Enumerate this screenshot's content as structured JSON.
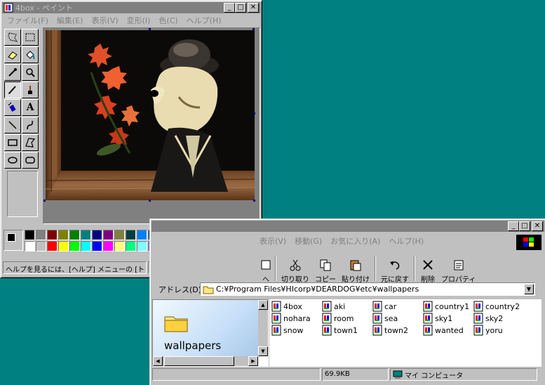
{
  "paint": {
    "title": "4box - ペイント",
    "menu": [
      "ファイル(F)",
      "編集(E)",
      "表示(V)",
      "変形(I)",
      "色(C)",
      "ヘルプ(H)"
    ],
    "status": "ヘルプを見るには、[ヘルプ] メニューの [トピッ"
  },
  "explorer": {
    "menu": [
      "表示(V)",
      "移動(G)",
      "お気に入り(A)",
      "ヘルプ(H)"
    ],
    "toolbar": {
      "back_partial": "へ",
      "cut": "切り取り",
      "copy": "コピー",
      "paste": "貼り付け",
      "undo": "元に戻す",
      "delete": "削除",
      "properties": "プロパティ"
    },
    "address_label": "アドレス(D)",
    "address_value": "C:¥Program Files¥HIcorp¥DEARDOG¥etc¥wallpapers",
    "folder_name": "wallpapers",
    "files": [
      "4box",
      "aki",
      "car",
      "country1",
      "country2",
      "nohara",
      "room",
      "sea",
      "sky1",
      "sky2",
      "snow",
      "town1",
      "town2",
      "wanted",
      "yoru"
    ],
    "status_size": "69.9KB",
    "status_location": "マイ コンピュータ"
  },
  "colors": {
    "palette_top": [
      "#000000",
      "#808080",
      "#800000",
      "#808000",
      "#008000",
      "#008080",
      "#000080",
      "#800080",
      "#808040",
      "#004040",
      "#0080ff",
      "#004080",
      "#4000ff",
      "#804000"
    ],
    "palette_bottom": [
      "#ffffff",
      "#c0c0c0",
      "#ff0000",
      "#ffff00",
      "#00ff00",
      "#00ffff",
      "#0000ff",
      "#ff00ff",
      "#ffff80",
      "#00ff80",
      "#80ffff",
      "#8080ff",
      "#ff0080",
      "#ff8040"
    ]
  }
}
